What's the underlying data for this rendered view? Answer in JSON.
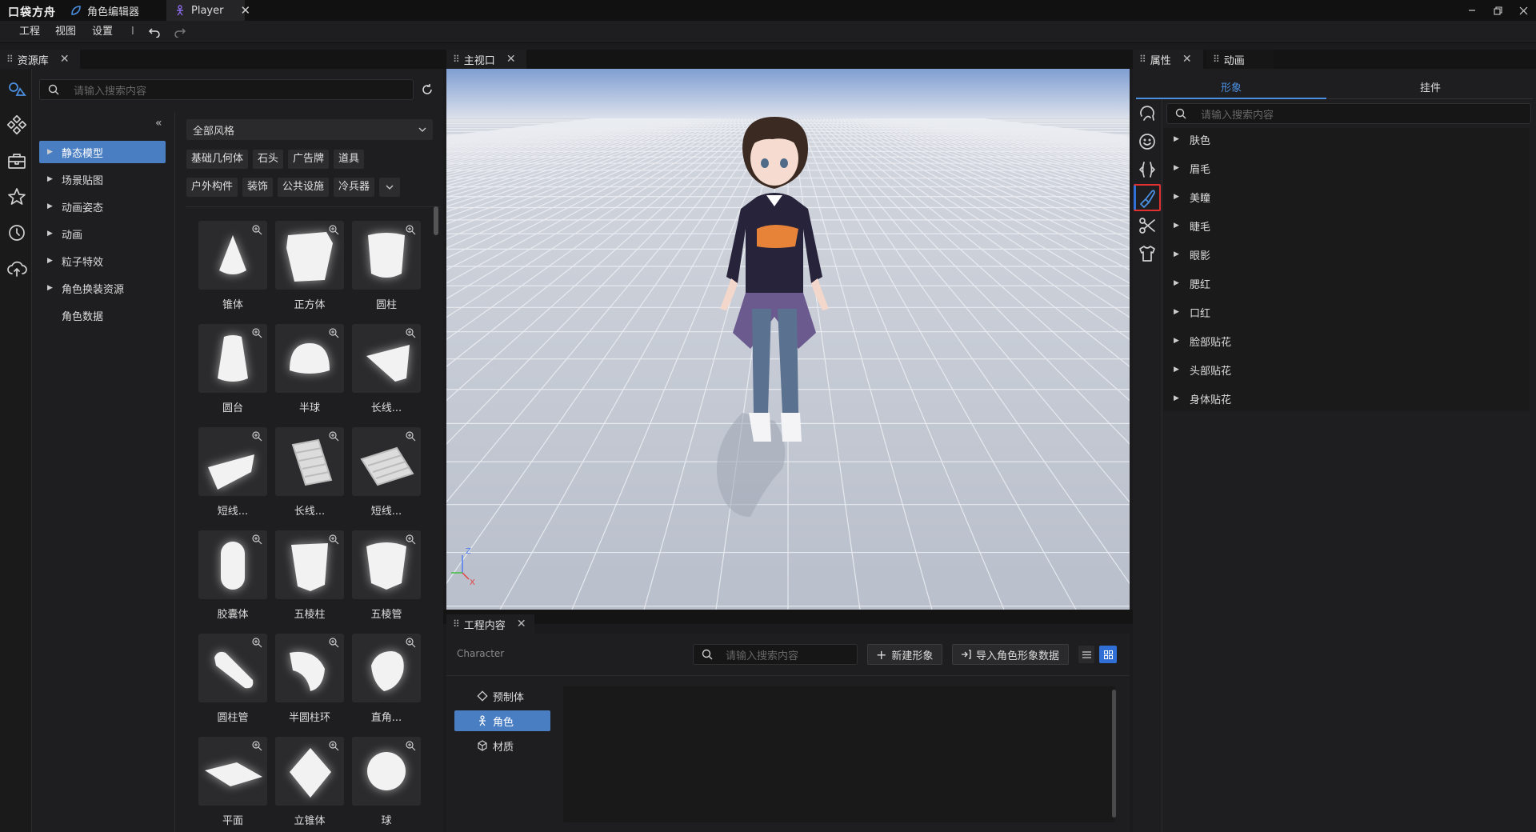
{
  "app": {
    "logo": "口袋方舟",
    "tabs": [
      {
        "label": "角色编辑器",
        "icon": "editor-icon"
      },
      {
        "label": "Player",
        "icon": "player-icon"
      }
    ]
  },
  "menu": {
    "items": [
      "工程",
      "视图",
      "设置"
    ],
    "separator": "I"
  },
  "asset_panel": {
    "tab_label": "资源库",
    "search_placeholder": "请输入搜索内容",
    "tree": [
      {
        "label": "静态模型",
        "expandable": true,
        "selected": true
      },
      {
        "label": "场景贴图",
        "expandable": true
      },
      {
        "label": "动画姿态",
        "expandable": true
      },
      {
        "label": "动画",
        "expandable": true
      },
      {
        "label": "粒子特效",
        "expandable": true
      },
      {
        "label": "角色换装资源",
        "expandable": true
      },
      {
        "label": "角色数据",
        "expandable": false
      }
    ],
    "style_select": "全部风格",
    "chips_row1": [
      "基础几何体",
      "石头",
      "广告牌",
      "道具"
    ],
    "chips_row2": [
      "户外构件",
      "装饰",
      "公共设施",
      "冷兵器"
    ],
    "assets": [
      {
        "label": "锥体",
        "shape": "cone"
      },
      {
        "label": "正方体",
        "shape": "cube"
      },
      {
        "label": "圆柱",
        "shape": "cylinder"
      },
      {
        "label": "圆台",
        "shape": "frustum"
      },
      {
        "label": "半球",
        "shape": "hemisphere"
      },
      {
        "label": "长线...",
        "shape": "wedge"
      },
      {
        "label": "短线...",
        "shape": "short-wedge"
      },
      {
        "label": "长线...",
        "shape": "long-stairs"
      },
      {
        "label": "短线...",
        "shape": "short-stairs"
      },
      {
        "label": "胶囊体",
        "shape": "capsule"
      },
      {
        "label": "五棱柱",
        "shape": "pentaprism"
      },
      {
        "label": "五棱管",
        "shape": "pentatube"
      },
      {
        "label": "圆柱管",
        "shape": "tube"
      },
      {
        "label": "半圆柱环",
        "shape": "half-ring"
      },
      {
        "label": "直角...",
        "shape": "right-angle"
      },
      {
        "label": "平面",
        "shape": "plane"
      },
      {
        "label": "立锥体",
        "shape": "diamond"
      },
      {
        "label": "球",
        "shape": "sphere"
      }
    ]
  },
  "viewport": {
    "tab_label": "主视口",
    "axes": {
      "z": "Z",
      "x": "X"
    },
    "colors": {
      "sky": "#8fa9d4",
      "floor": "#c9ced8"
    }
  },
  "project": {
    "tab_label": "工程内容",
    "breadcrumb": "Character",
    "search_placeholder": "请输入搜索内容",
    "new_button": "新建形象",
    "import_button": "导入角色形象数据",
    "categories": [
      {
        "label": "预制体",
        "icon": "prefab-icon"
      },
      {
        "label": "角色",
        "icon": "character-icon",
        "selected": true
      },
      {
        "label": "材质",
        "icon": "material-icon"
      }
    ]
  },
  "right_panel": {
    "tabs": [
      "属性",
      "动画"
    ],
    "subtabs": [
      "形象",
      "挂件"
    ],
    "active_subtab": "形象",
    "search_placeholder": "请输入搜索内容",
    "items": [
      "肤色",
      "眉毛",
      "美瞳",
      "睫毛",
      "眼影",
      "腮红",
      "口红",
      "脸部贴花",
      "头部贴花",
      "身体贴花"
    ],
    "side_icons": [
      "hair-icon",
      "face-icon",
      "body-shape-icon",
      "makeup-brush-icon",
      "scissors-icon",
      "shirt-icon"
    ],
    "active_side_icon": "makeup-brush-icon",
    "highlight_color": "#e03030"
  },
  "accent": "#4a7ec2"
}
